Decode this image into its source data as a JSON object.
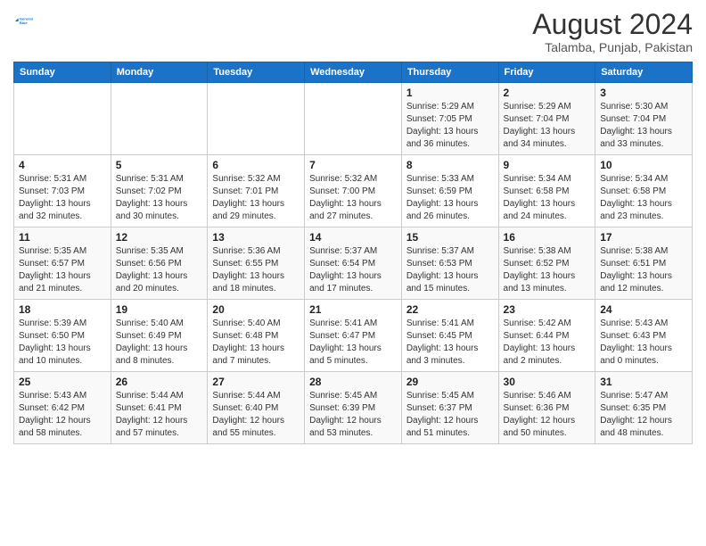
{
  "header": {
    "logo_line1": "General",
    "logo_line2": "Blue",
    "title": "August 2024",
    "subtitle": "Talamba, Punjab, Pakistan"
  },
  "days_of_week": [
    "Sunday",
    "Monday",
    "Tuesday",
    "Wednesday",
    "Thursday",
    "Friday",
    "Saturday"
  ],
  "weeks": [
    [
      {
        "day": "",
        "info": ""
      },
      {
        "day": "",
        "info": ""
      },
      {
        "day": "",
        "info": ""
      },
      {
        "day": "",
        "info": ""
      },
      {
        "day": "1",
        "info": "Sunrise: 5:29 AM\nSunset: 7:05 PM\nDaylight: 13 hours\nand 36 minutes."
      },
      {
        "day": "2",
        "info": "Sunrise: 5:29 AM\nSunset: 7:04 PM\nDaylight: 13 hours\nand 34 minutes."
      },
      {
        "day": "3",
        "info": "Sunrise: 5:30 AM\nSunset: 7:04 PM\nDaylight: 13 hours\nand 33 minutes."
      }
    ],
    [
      {
        "day": "4",
        "info": "Sunrise: 5:31 AM\nSunset: 7:03 PM\nDaylight: 13 hours\nand 32 minutes."
      },
      {
        "day": "5",
        "info": "Sunrise: 5:31 AM\nSunset: 7:02 PM\nDaylight: 13 hours\nand 30 minutes."
      },
      {
        "day": "6",
        "info": "Sunrise: 5:32 AM\nSunset: 7:01 PM\nDaylight: 13 hours\nand 29 minutes."
      },
      {
        "day": "7",
        "info": "Sunrise: 5:32 AM\nSunset: 7:00 PM\nDaylight: 13 hours\nand 27 minutes."
      },
      {
        "day": "8",
        "info": "Sunrise: 5:33 AM\nSunset: 6:59 PM\nDaylight: 13 hours\nand 26 minutes."
      },
      {
        "day": "9",
        "info": "Sunrise: 5:34 AM\nSunset: 6:58 PM\nDaylight: 13 hours\nand 24 minutes."
      },
      {
        "day": "10",
        "info": "Sunrise: 5:34 AM\nSunset: 6:58 PM\nDaylight: 13 hours\nand 23 minutes."
      }
    ],
    [
      {
        "day": "11",
        "info": "Sunrise: 5:35 AM\nSunset: 6:57 PM\nDaylight: 13 hours\nand 21 minutes."
      },
      {
        "day": "12",
        "info": "Sunrise: 5:35 AM\nSunset: 6:56 PM\nDaylight: 13 hours\nand 20 minutes."
      },
      {
        "day": "13",
        "info": "Sunrise: 5:36 AM\nSunset: 6:55 PM\nDaylight: 13 hours\nand 18 minutes."
      },
      {
        "day": "14",
        "info": "Sunrise: 5:37 AM\nSunset: 6:54 PM\nDaylight: 13 hours\nand 17 minutes."
      },
      {
        "day": "15",
        "info": "Sunrise: 5:37 AM\nSunset: 6:53 PM\nDaylight: 13 hours\nand 15 minutes."
      },
      {
        "day": "16",
        "info": "Sunrise: 5:38 AM\nSunset: 6:52 PM\nDaylight: 13 hours\nand 13 minutes."
      },
      {
        "day": "17",
        "info": "Sunrise: 5:38 AM\nSunset: 6:51 PM\nDaylight: 13 hours\nand 12 minutes."
      }
    ],
    [
      {
        "day": "18",
        "info": "Sunrise: 5:39 AM\nSunset: 6:50 PM\nDaylight: 13 hours\nand 10 minutes."
      },
      {
        "day": "19",
        "info": "Sunrise: 5:40 AM\nSunset: 6:49 PM\nDaylight: 13 hours\nand 8 minutes."
      },
      {
        "day": "20",
        "info": "Sunrise: 5:40 AM\nSunset: 6:48 PM\nDaylight: 13 hours\nand 7 minutes."
      },
      {
        "day": "21",
        "info": "Sunrise: 5:41 AM\nSunset: 6:47 PM\nDaylight: 13 hours\nand 5 minutes."
      },
      {
        "day": "22",
        "info": "Sunrise: 5:41 AM\nSunset: 6:45 PM\nDaylight: 13 hours\nand 3 minutes."
      },
      {
        "day": "23",
        "info": "Sunrise: 5:42 AM\nSunset: 6:44 PM\nDaylight: 13 hours\nand 2 minutes."
      },
      {
        "day": "24",
        "info": "Sunrise: 5:43 AM\nSunset: 6:43 PM\nDaylight: 13 hours\nand 0 minutes."
      }
    ],
    [
      {
        "day": "25",
        "info": "Sunrise: 5:43 AM\nSunset: 6:42 PM\nDaylight: 12 hours\nand 58 minutes."
      },
      {
        "day": "26",
        "info": "Sunrise: 5:44 AM\nSunset: 6:41 PM\nDaylight: 12 hours\nand 57 minutes."
      },
      {
        "day": "27",
        "info": "Sunrise: 5:44 AM\nSunset: 6:40 PM\nDaylight: 12 hours\nand 55 minutes."
      },
      {
        "day": "28",
        "info": "Sunrise: 5:45 AM\nSunset: 6:39 PM\nDaylight: 12 hours\nand 53 minutes."
      },
      {
        "day": "29",
        "info": "Sunrise: 5:45 AM\nSunset: 6:37 PM\nDaylight: 12 hours\nand 51 minutes."
      },
      {
        "day": "30",
        "info": "Sunrise: 5:46 AM\nSunset: 6:36 PM\nDaylight: 12 hours\nand 50 minutes."
      },
      {
        "day": "31",
        "info": "Sunrise: 5:47 AM\nSunset: 6:35 PM\nDaylight: 12 hours\nand 48 minutes."
      }
    ]
  ]
}
